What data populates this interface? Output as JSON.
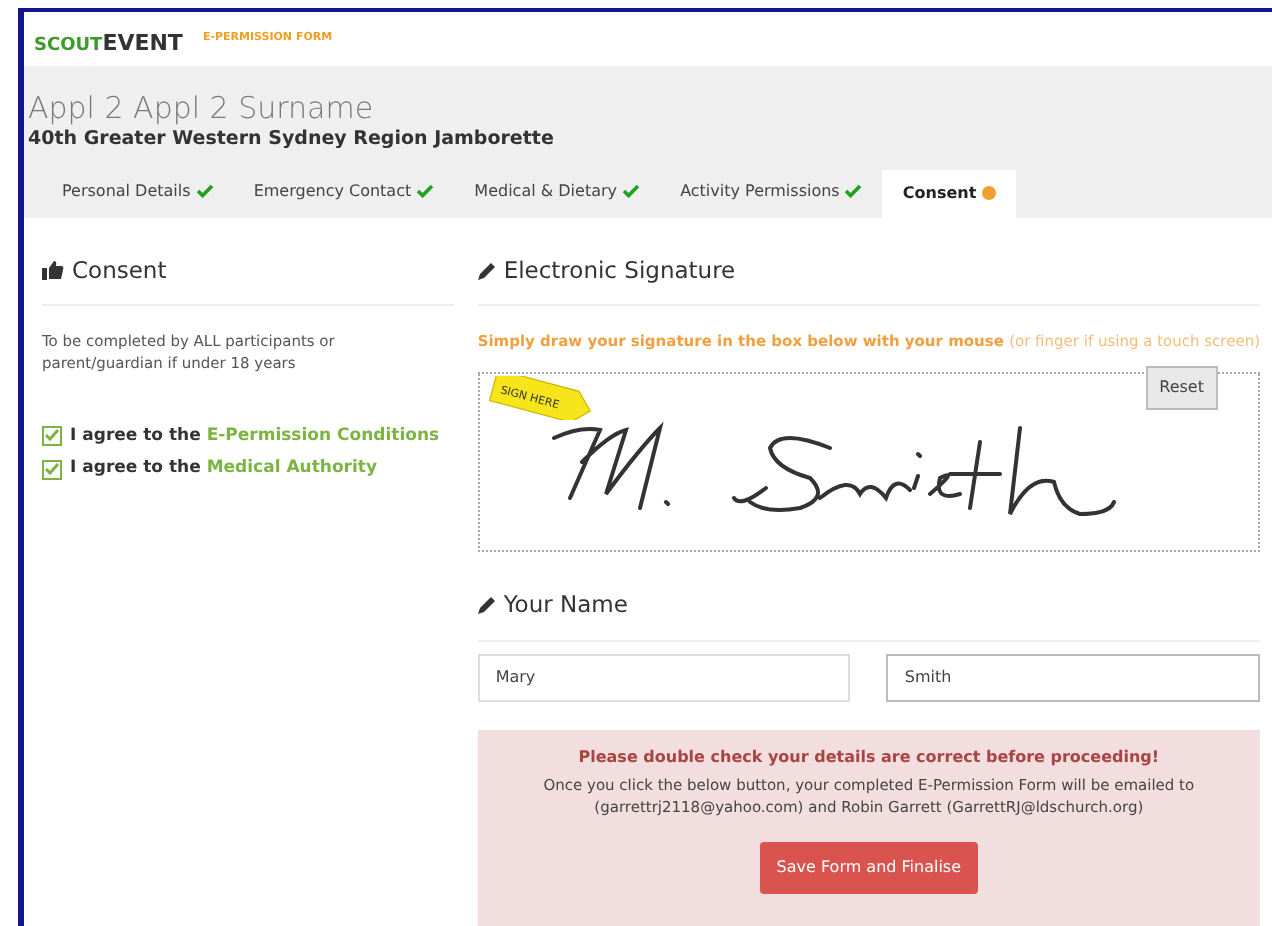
{
  "header": {
    "logo": [
      "SCOUT",
      "EVENT"
    ],
    "form_label": "E-PERMISSION FORM"
  },
  "title": "Appl 2 Appl 2 Surname",
  "subtitle": "40th Greater Western Sydney Region Jamborette",
  "tabs": [
    {
      "label": "Personal Details",
      "complete": true,
      "selected": false
    },
    {
      "label": "Emergency Contact",
      "complete": true,
      "selected": false
    },
    {
      "label": "Medical & Dietary",
      "complete": true,
      "selected": false
    },
    {
      "label": "Activity Permissions",
      "complete": true,
      "selected": false
    },
    {
      "label": "Consent",
      "complete": false,
      "selected": true
    }
  ],
  "consent": {
    "heading": "Consent",
    "note": "To be completed by ALL participants or parent/guardian if under 18 years",
    "agreements": [
      {
        "prefix": "I agree to the",
        "link": "E-Permission Conditions",
        "checked": true
      },
      {
        "prefix": "I agree to the",
        "link": "Medical Authority",
        "checked": true
      }
    ]
  },
  "signature": {
    "heading": "Electronic Signature",
    "instruction": "Simply draw your signature in the box below with your mouse",
    "instruction_hint": "(or finger if using a touch screen)",
    "sign_here": "SIGN HERE",
    "reset": "Reset"
  },
  "your_name": {
    "heading": "Your Name",
    "first_name": "Mary",
    "last_name": "Smith"
  },
  "notice": {
    "warning": "Please double check your details are correct before proceeding!",
    "message": "Once you click the below button, your completed E-Permission Form will be emailed to (garrettrj2118@yahoo.com) and Robin Garrett (GarrettRJ@ldschurch.org)",
    "button": "Save Form and Finalise"
  }
}
